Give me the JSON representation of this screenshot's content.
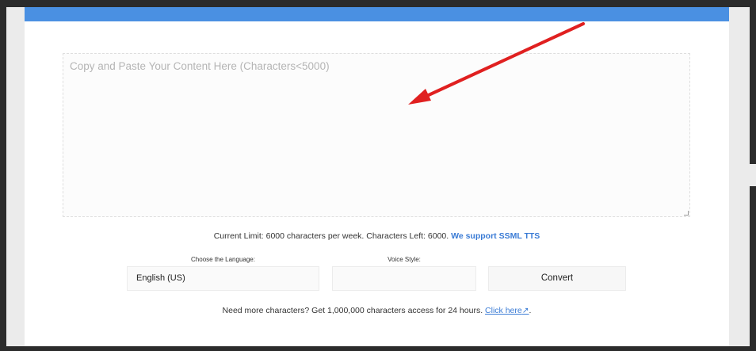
{
  "editor": {
    "placeholder": "Copy and Paste Your Content Here (Characters<5000)"
  },
  "limit": {
    "text": "Current Limit: 6000 characters per week. Characters Left: 6000.",
    "ssml_link": "We support SSML TTS"
  },
  "language": {
    "label": "Choose the Language:",
    "selected": "English (US)"
  },
  "voice": {
    "label": "Voice Style:",
    "selected": ""
  },
  "convert": {
    "label": "Convert"
  },
  "more": {
    "text": "Need more characters? Get 1,000,000 characters access for 24 hours.",
    "link": "Click here",
    "link_icon": "↗",
    "suffix": "."
  },
  "colors": {
    "accent": "#4a90e2",
    "link": "#3a7bd5",
    "annotation_arrow": "#e02020"
  },
  "icons": {
    "annotation": "red-arrow-icon",
    "external_link": "external-link-icon"
  }
}
